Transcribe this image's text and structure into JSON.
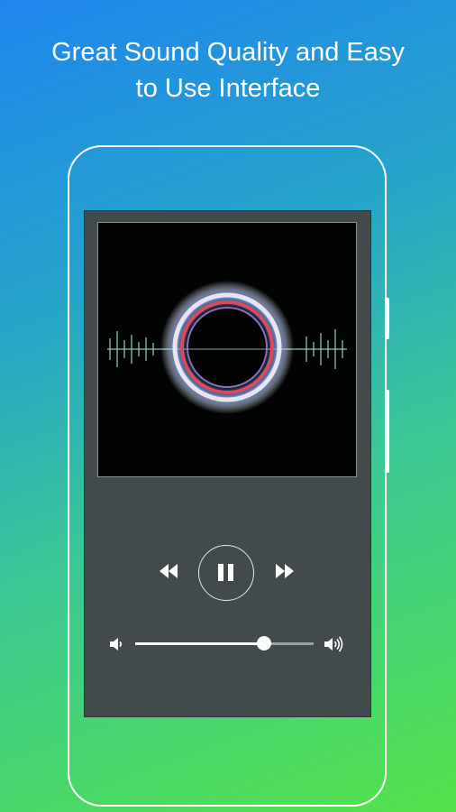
{
  "header": {
    "line1": "Great Sound Quality and Easy",
    "line2": "to Use Interface"
  },
  "player": {
    "artwork_icon": "glowing-ring-equalizer-artwork",
    "controls": {
      "rewind_icon": "rewind-icon",
      "pause_icon": "pause-icon",
      "forward_icon": "fast-forward-icon"
    },
    "volume": {
      "level": 0.72,
      "low_icon": "volume-low-icon",
      "high_icon": "volume-high-icon"
    }
  },
  "colors": {
    "gradient_top": "#1f86ee",
    "gradient_bottom": "#55e24a",
    "screen_bg": "#434a4b",
    "control_color": "#ffffff"
  }
}
